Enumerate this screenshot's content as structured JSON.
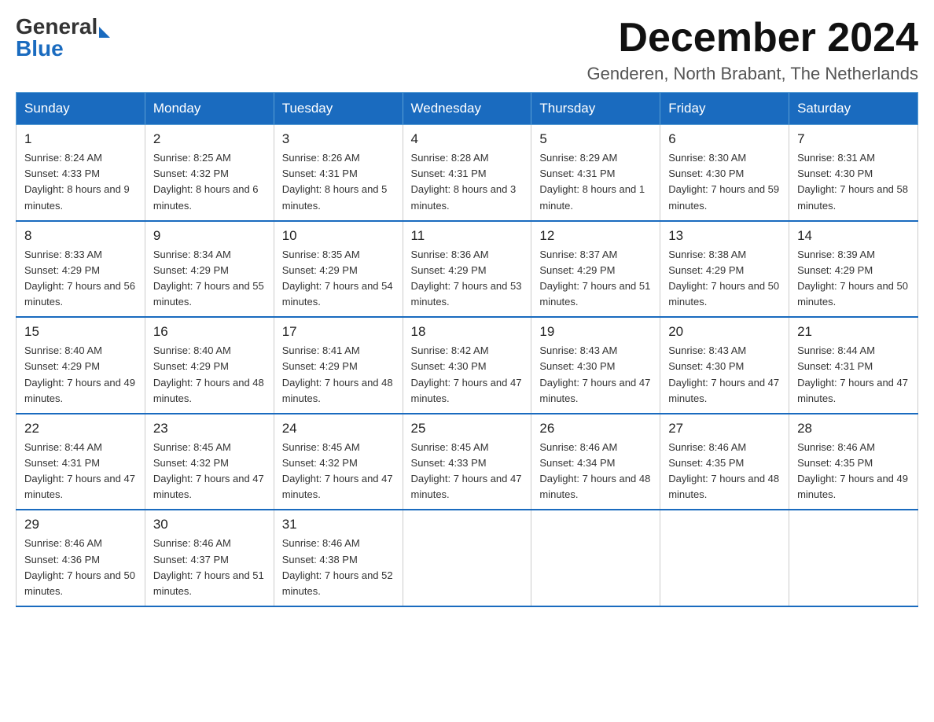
{
  "logo": {
    "general": "General",
    "blue": "Blue",
    "tagline": "GeneralBlue"
  },
  "header": {
    "month_year": "December 2024",
    "location": "Genderen, North Brabant, The Netherlands"
  },
  "weekdays": [
    "Sunday",
    "Monday",
    "Tuesday",
    "Wednesday",
    "Thursday",
    "Friday",
    "Saturday"
  ],
  "weeks": [
    [
      {
        "day": "1",
        "sunrise": "8:24 AM",
        "sunset": "4:33 PM",
        "daylight": "8 hours and 9 minutes."
      },
      {
        "day": "2",
        "sunrise": "8:25 AM",
        "sunset": "4:32 PM",
        "daylight": "8 hours and 6 minutes."
      },
      {
        "day": "3",
        "sunrise": "8:26 AM",
        "sunset": "4:31 PM",
        "daylight": "8 hours and 5 minutes."
      },
      {
        "day": "4",
        "sunrise": "8:28 AM",
        "sunset": "4:31 PM",
        "daylight": "8 hours and 3 minutes."
      },
      {
        "day": "5",
        "sunrise": "8:29 AM",
        "sunset": "4:31 PM",
        "daylight": "8 hours and 1 minute."
      },
      {
        "day": "6",
        "sunrise": "8:30 AM",
        "sunset": "4:30 PM",
        "daylight": "7 hours and 59 minutes."
      },
      {
        "day": "7",
        "sunrise": "8:31 AM",
        "sunset": "4:30 PM",
        "daylight": "7 hours and 58 minutes."
      }
    ],
    [
      {
        "day": "8",
        "sunrise": "8:33 AM",
        "sunset": "4:29 PM",
        "daylight": "7 hours and 56 minutes."
      },
      {
        "day": "9",
        "sunrise": "8:34 AM",
        "sunset": "4:29 PM",
        "daylight": "7 hours and 55 minutes."
      },
      {
        "day": "10",
        "sunrise": "8:35 AM",
        "sunset": "4:29 PM",
        "daylight": "7 hours and 54 minutes."
      },
      {
        "day": "11",
        "sunrise": "8:36 AM",
        "sunset": "4:29 PM",
        "daylight": "7 hours and 53 minutes."
      },
      {
        "day": "12",
        "sunrise": "8:37 AM",
        "sunset": "4:29 PM",
        "daylight": "7 hours and 51 minutes."
      },
      {
        "day": "13",
        "sunrise": "8:38 AM",
        "sunset": "4:29 PM",
        "daylight": "7 hours and 50 minutes."
      },
      {
        "day": "14",
        "sunrise": "8:39 AM",
        "sunset": "4:29 PM",
        "daylight": "7 hours and 50 minutes."
      }
    ],
    [
      {
        "day": "15",
        "sunrise": "8:40 AM",
        "sunset": "4:29 PM",
        "daylight": "7 hours and 49 minutes."
      },
      {
        "day": "16",
        "sunrise": "8:40 AM",
        "sunset": "4:29 PM",
        "daylight": "7 hours and 48 minutes."
      },
      {
        "day": "17",
        "sunrise": "8:41 AM",
        "sunset": "4:29 PM",
        "daylight": "7 hours and 48 minutes."
      },
      {
        "day": "18",
        "sunrise": "8:42 AM",
        "sunset": "4:30 PM",
        "daylight": "7 hours and 47 minutes."
      },
      {
        "day": "19",
        "sunrise": "8:43 AM",
        "sunset": "4:30 PM",
        "daylight": "7 hours and 47 minutes."
      },
      {
        "day": "20",
        "sunrise": "8:43 AM",
        "sunset": "4:30 PM",
        "daylight": "7 hours and 47 minutes."
      },
      {
        "day": "21",
        "sunrise": "8:44 AM",
        "sunset": "4:31 PM",
        "daylight": "7 hours and 47 minutes."
      }
    ],
    [
      {
        "day": "22",
        "sunrise": "8:44 AM",
        "sunset": "4:31 PM",
        "daylight": "7 hours and 47 minutes."
      },
      {
        "day": "23",
        "sunrise": "8:45 AM",
        "sunset": "4:32 PM",
        "daylight": "7 hours and 47 minutes."
      },
      {
        "day": "24",
        "sunrise": "8:45 AM",
        "sunset": "4:32 PM",
        "daylight": "7 hours and 47 minutes."
      },
      {
        "day": "25",
        "sunrise": "8:45 AM",
        "sunset": "4:33 PM",
        "daylight": "7 hours and 47 minutes."
      },
      {
        "day": "26",
        "sunrise": "8:46 AM",
        "sunset": "4:34 PM",
        "daylight": "7 hours and 48 minutes."
      },
      {
        "day": "27",
        "sunrise": "8:46 AM",
        "sunset": "4:35 PM",
        "daylight": "7 hours and 48 minutes."
      },
      {
        "day": "28",
        "sunrise": "8:46 AM",
        "sunset": "4:35 PM",
        "daylight": "7 hours and 49 minutes."
      }
    ],
    [
      {
        "day": "29",
        "sunrise": "8:46 AM",
        "sunset": "4:36 PM",
        "daylight": "7 hours and 50 minutes."
      },
      {
        "day": "30",
        "sunrise": "8:46 AM",
        "sunset": "4:37 PM",
        "daylight": "7 hours and 51 minutes."
      },
      {
        "day": "31",
        "sunrise": "8:46 AM",
        "sunset": "4:38 PM",
        "daylight": "7 hours and 52 minutes."
      },
      null,
      null,
      null,
      null
    ]
  ]
}
